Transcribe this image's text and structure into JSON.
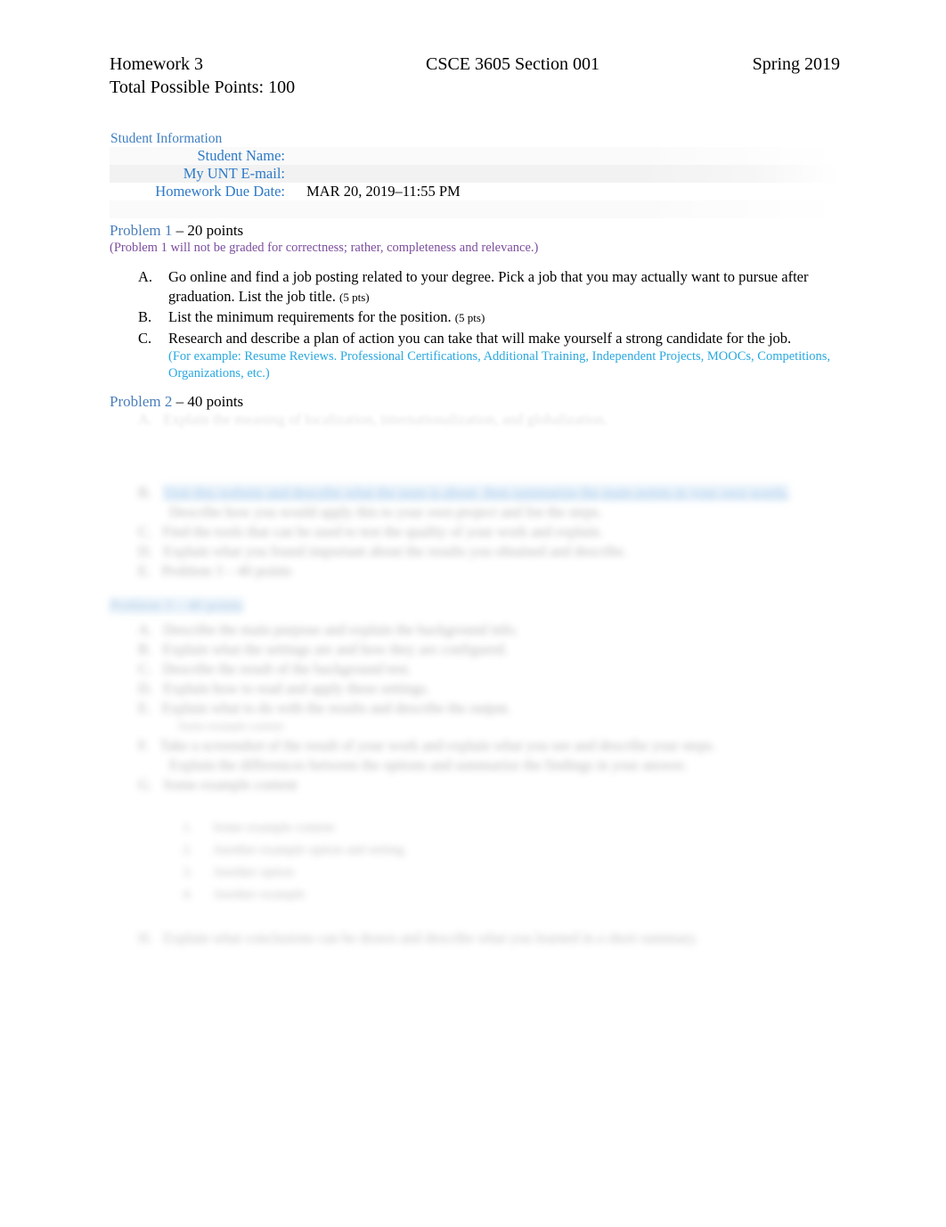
{
  "document": {
    "type": "homework-assignment",
    "colors": {
      "heading_blue": "#4a7ebb",
      "label_blue": "#2d79c7",
      "note_purple": "#7d4e9e",
      "subnote_cyan": "#29a8e0",
      "link_blue": "#2f7fd0",
      "highlight": "#cfe4f5",
      "page_background": "#ffffff",
      "row_shade": "#f2f2f2"
    }
  },
  "header": {
    "assignment": "Homework 3",
    "course": "CSCE 3605 Section 001",
    "term": "Spring 2019",
    "total_points": "Total Possible Points: 100"
  },
  "student_information": {
    "title": "Student Information",
    "rows": [
      {
        "label": "Student Name:",
        "value": ""
      },
      {
        "label": "My UNT E-mail:",
        "value": ""
      },
      {
        "label": "Homework Due Date:",
        "value": "MAR 20, 2019–11:55 PM"
      }
    ]
  },
  "problem1": {
    "name": "Problem 1",
    "points": " – 20 points",
    "note": "(Problem 1 will not be graded for correctness; rather, completeness and relevance.)",
    "items": [
      {
        "marker": "A.",
        "text": "Go online and find a job posting related to your degree.   Pick a job that you may actually want to pursue after graduation.   List the job title. ",
        "pts": "(5 pts)",
        "subnote": ""
      },
      {
        "marker": "B.",
        "text": "List the minimum requirements for the position.  ",
        "pts": "(5 pts)",
        "subnote": ""
      },
      {
        "marker": "C.",
        "text": "Research and describe a plan of action you can take that will make yourself a strong candidate for the job.",
        "pts": "",
        "subnote": "(For example: Resume Reviews. Professional Certifications, Additional Training, Independent Projects, MOOCs, Competitions, Organizations, etc.)"
      }
    ]
  },
  "problem2": {
    "name": "Problem 2",
    "points": " – 40 points"
  },
  "redacted": {
    "description": "Content below Problem 2 heading is blurred and illegible in the source screenshot.",
    "lines": [
      {
        "marker": "A.",
        "text": "Explain the meaning of localization, internationalization, and globalization."
      },
      {
        "marker": "B.",
        "text": "Visit this website and describe what the page is about, then summarize the main points in your own words."
      },
      {
        "marker": "C.",
        "text": "Describe how you would apply this to your own project and list the steps."
      },
      {
        "marker": "D.",
        "text": "Find the tools that can be used to test the quality of your work and explain."
      },
      {
        "marker": "E.",
        "text": "Explain what you found important about the results you obtained and describe."
      },
      {
        "marker": "F.",
        "text": "Problem 3 – 40 points"
      },
      {
        "marker": "A.",
        "text": "Describe the main purpose and explain the background info."
      },
      {
        "marker": "B.",
        "text": "Explain what the settings are and how they are configured."
      },
      {
        "marker": "C.",
        "text": "Describe the result of the background test."
      },
      {
        "marker": "D.",
        "text": "Explain how to read and apply these settings."
      },
      {
        "marker": "E.",
        "text": "Explain what to do with the results and describe the output."
      },
      {
        "marker": "F.",
        "text": "Take a screenshot of the result of your work and explain what you see and describe your steps."
      },
      {
        "marker": "G.",
        "text": "Explain the differences between the options and summarize the findings in your answer."
      },
      {
        "marker": "1.",
        "text": "Some example content"
      },
      {
        "marker": "2.",
        "text": "Another example option and setting"
      },
      {
        "marker": "3.",
        "text": "Another option"
      },
      {
        "marker": "4.",
        "text": "Another example"
      },
      {
        "marker": "H.",
        "text": "Explain what conclusions can be drawn and describe what you learned in a short summary."
      }
    ]
  }
}
